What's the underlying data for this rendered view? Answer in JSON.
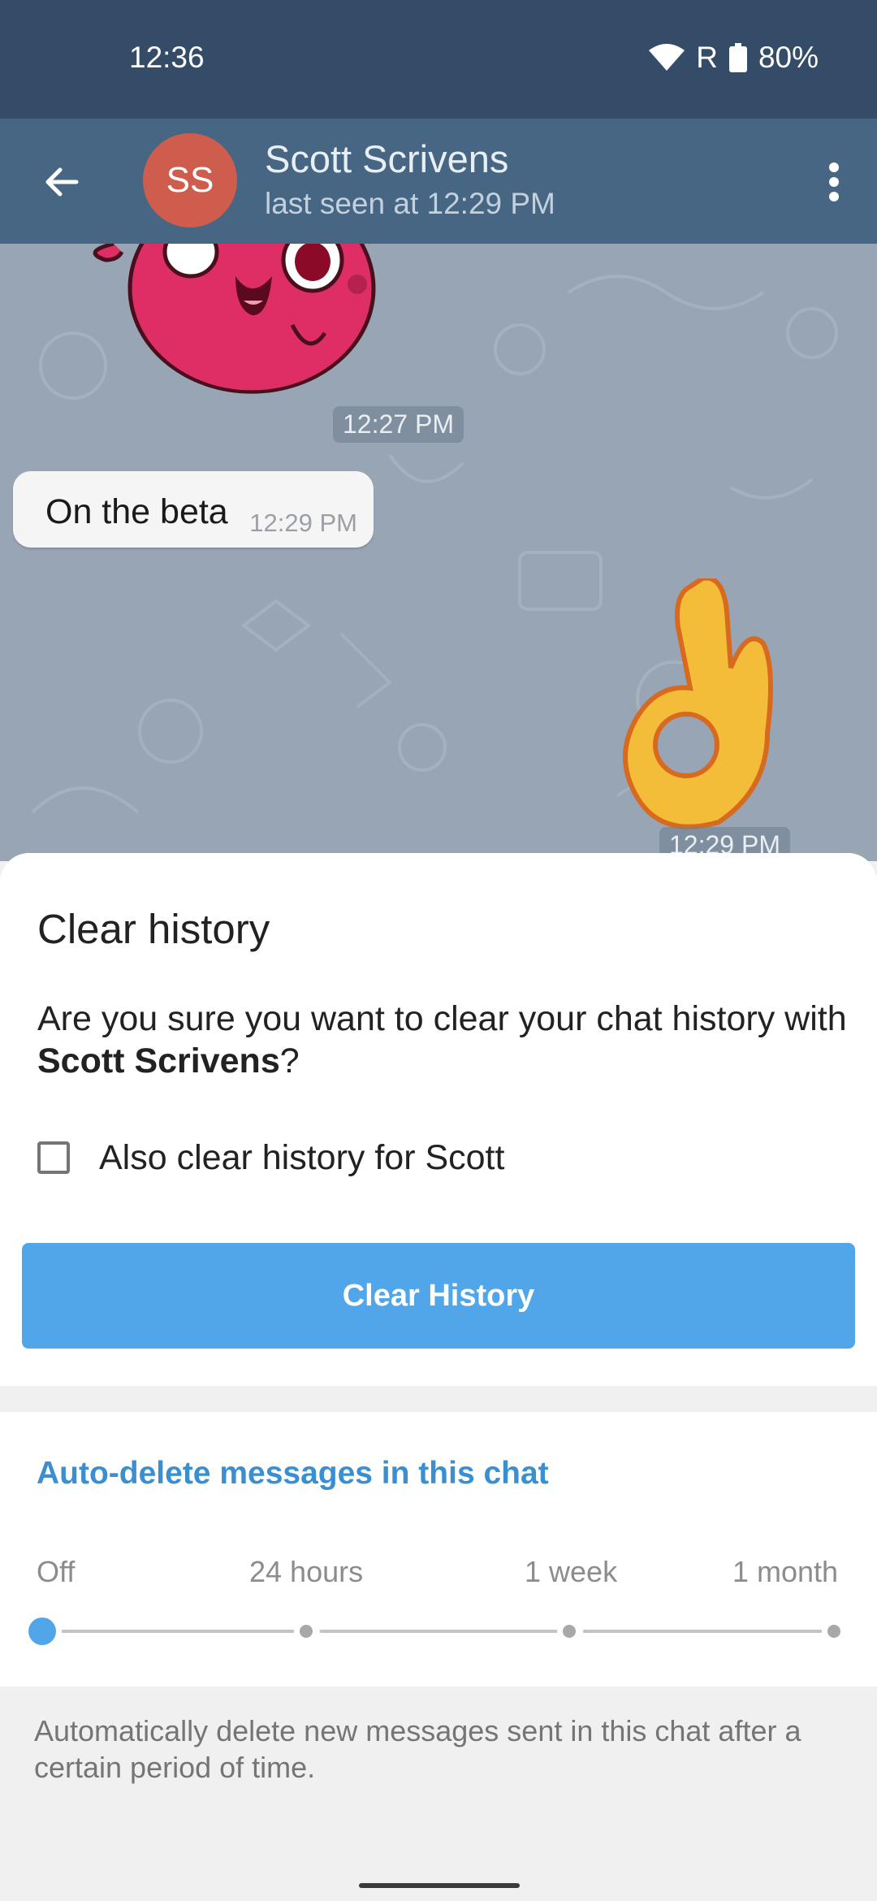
{
  "status_bar": {
    "time": "12:36",
    "network": "R",
    "battery": "80%",
    "icons": [
      "wifi-icon",
      "battery-icon"
    ]
  },
  "header": {
    "avatar_initials": "SS",
    "name": "Scott Scrivens",
    "last_seen": "last seen at 12:29 PM",
    "icons": [
      "back-arrow-icon",
      "more-vert-icon"
    ]
  },
  "chat": {
    "sticker1_time": "12:27 PM",
    "message_text": "On the beta",
    "message_time": "12:29 PM",
    "sticker2_time": "12:29 PM"
  },
  "dialog": {
    "title": "Clear history",
    "message_prefix": "Are you sure you want to clear your chat history with ",
    "message_name": "Scott Scrivens",
    "message_suffix": "?",
    "checkbox_label": "Also clear history for Scott",
    "checkbox_checked": false,
    "button_label": "Clear History"
  },
  "auto_delete": {
    "title": "Auto-delete messages in this chat",
    "options": [
      "Off",
      "24 hours",
      "1 week",
      "1 month"
    ],
    "selected": "Off",
    "description": "Automatically delete new messages sent in this chat after a certain period of time."
  },
  "colors": {
    "status_bar": "#344c67",
    "app_bar": "#466683",
    "accent": "#50a6e9",
    "link_blue": "#3a8fd1",
    "avatar": "#cf5d4d"
  }
}
